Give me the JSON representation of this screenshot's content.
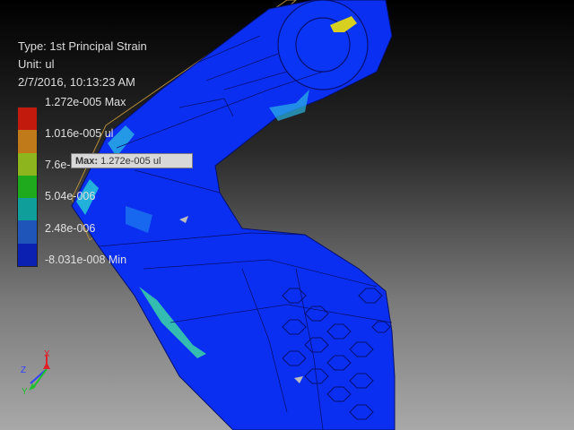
{
  "result_info": {
    "type_line": "Type: 1st Principal Strain",
    "unit_line": "Unit: ul",
    "date_line": "2/7/2016, 10:13:23 AM"
  },
  "legend": {
    "labels": [
      "1.272e-005 Max",
      "1.016e-005 ul",
      "7.6e-006",
      "5.04e-006",
      "2.48e-006",
      "-8.031e-008 Min"
    ],
    "colors": [
      "#c21a0c",
      "#c07a1a",
      "#8db51e",
      "#1faa1e",
      "#0f9e9a",
      "#1f55b8",
      "#0b1fb0"
    ]
  },
  "probe": {
    "prefix": "Max:",
    "value": "1.272e-005 ul"
  },
  "triad": {
    "x_label": "X",
    "y_label": "Y",
    "z_label": "Z",
    "x_color": "#e0202a",
    "y_color": "#20c030",
    "z_color": "#3040ff"
  },
  "model": {
    "part_color": "#0a2ff0",
    "high_strain_color": "#27c8d6",
    "max_color": "#d8d020"
  }
}
